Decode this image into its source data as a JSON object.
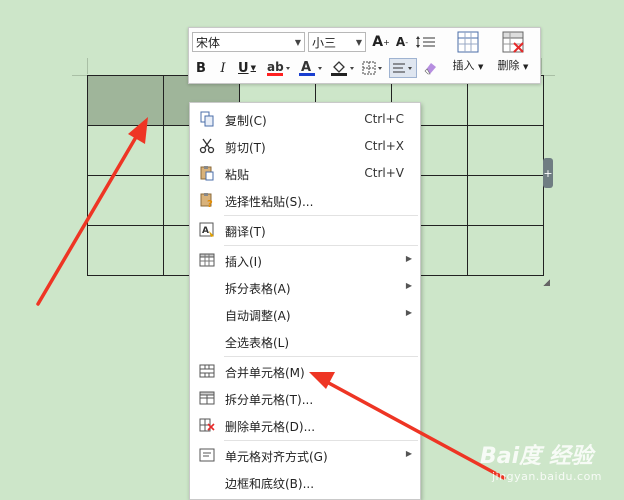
{
  "toolbar": {
    "font_name": "宋体",
    "font_size": "小三",
    "insert_label": "插入",
    "delete_label": "删除",
    "bold": "B",
    "italic": "I",
    "underline": "U",
    "grow_font": "A",
    "shrink_font": "A",
    "colors": {
      "highlight": "#ff2020",
      "font_color": "#1a3fd0",
      "fill": "#222222"
    }
  },
  "context_menu": {
    "items": [
      {
        "label": "复制(C)",
        "shortcut": "Ctrl+C",
        "icon": "copy-icon"
      },
      {
        "label": "剪切(T)",
        "shortcut": "Ctrl+X",
        "icon": "scissors-icon"
      },
      {
        "label": "粘贴",
        "shortcut": "Ctrl+V",
        "icon": "paste-icon"
      },
      {
        "label": "选择性粘贴(S)...",
        "shortcut": "",
        "icon": "paste-special-icon"
      },
      {
        "label": "翻译(T)",
        "shortcut": "",
        "icon": "translate-icon"
      },
      {
        "label": "插入(I)",
        "shortcut": "",
        "icon": "table-insert-icon",
        "submenu": true
      },
      {
        "label": "拆分表格(A)",
        "shortcut": "",
        "icon": "",
        "submenu": true
      },
      {
        "label": "自动调整(A)",
        "shortcut": "",
        "icon": "",
        "submenu": true
      },
      {
        "label": "全选表格(L)",
        "shortcut": "",
        "icon": ""
      },
      {
        "label": "合并单元格(M)",
        "shortcut": "",
        "icon": "merge-cells-icon"
      },
      {
        "label": "拆分单元格(T)...",
        "shortcut": "",
        "icon": "split-cells-icon"
      },
      {
        "label": "删除单元格(D)...",
        "shortcut": "",
        "icon": "delete-cells-icon"
      },
      {
        "label": "单元格对齐方式(G)",
        "shortcut": "",
        "icon": "cell-align-icon",
        "submenu": true
      },
      {
        "label": "边框和底纹(B)...",
        "shortcut": "",
        "icon": ""
      }
    ]
  },
  "watermark": {
    "main": "Bai度 经验",
    "sub": "jingyan.baidu.com"
  },
  "accent_arrow_color": "#ee3524"
}
